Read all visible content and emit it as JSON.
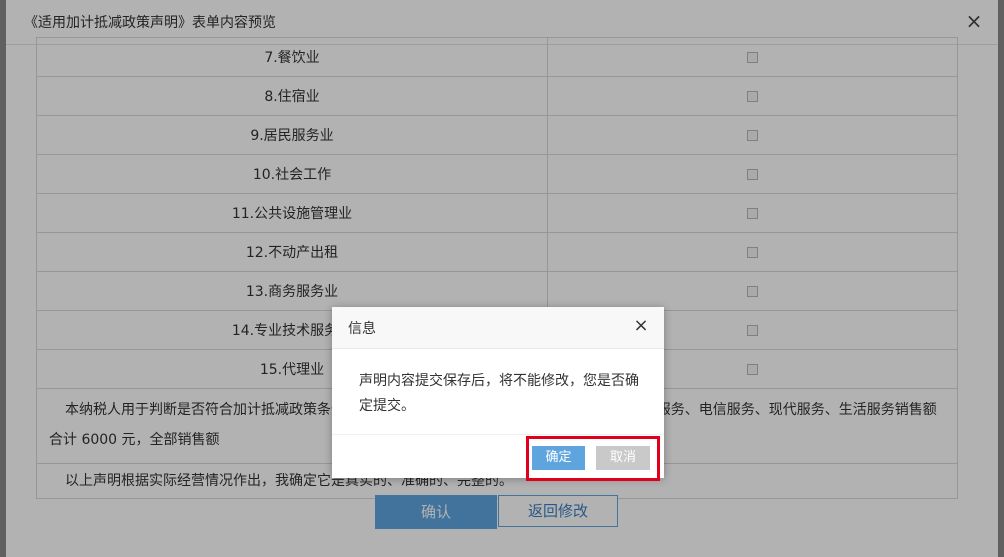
{
  "outer_dialog": {
    "title": "《适用加计抵减政策声明》表单内容预览",
    "close_glyph": "×",
    "rows": [
      {
        "name": "7.餐饮业"
      },
      {
        "name": "8.住宿业"
      },
      {
        "name": "9.居民服务业"
      },
      {
        "name": "10.社会工作"
      },
      {
        "name": "11.公共设施管理业"
      },
      {
        "name": "12.不动产出租"
      },
      {
        "name": "13.商务服务业"
      },
      {
        "name": "14.专业技术服务业"
      },
      {
        "name": "15.代理业"
      }
    ],
    "statement_1": "本纳税人用于判断是否符合加计抵减政策条件的销售额评估期为 年 月至 年 月，此期间提供邮政服务、电信服务、现代服务、生活服务销售额合计 6000 元，全部销售额",
    "statement_2": "以上声明根据实际经营情况作出，我确定它是真实的、准确的、完整的。",
    "confirm_label": "确认",
    "back_label": "返回修改"
  },
  "modal": {
    "title": "信息",
    "close_glyph": "×",
    "message": "声明内容提交保存后，将不能修改，您是否确定提交。",
    "ok_label": "确定",
    "cancel_label": "取消"
  },
  "colors": {
    "accent": "#5ea5e0",
    "highlight": "#e0001b",
    "cancel_bg": "#c9c9c9"
  }
}
